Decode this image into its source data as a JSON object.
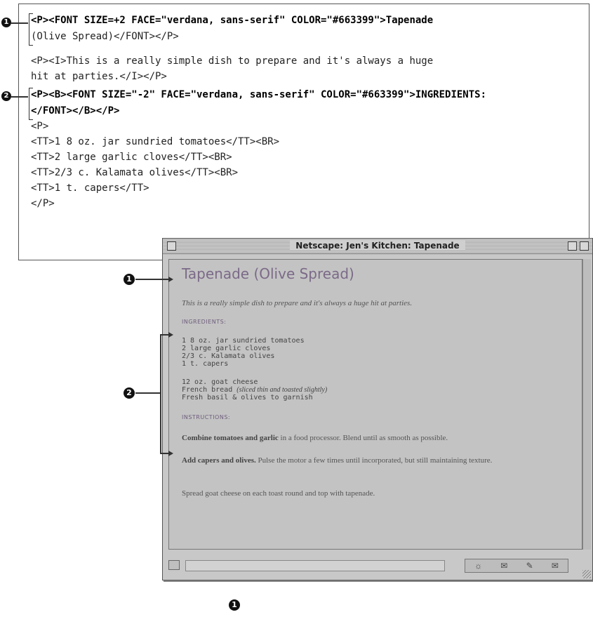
{
  "code_listing": {
    "lines": [
      "<P><FONT SIZE=+2 FACE=\"verdana, sans-serif\" COLOR=\"#663399\">Tapenade",
      "(Olive Spread)</FONT></P>",
      "<P><I>This is a really simple dish to prepare and it's always a huge",
      "hit at parties.</I></P>",
      "<P><B><FONT SIZE=\"-2\" FACE=\"verdana, sans-serif\" COLOR=\"#663399\">INGREDIENTS:",
      "</FONT></B></P>",
      "<P>",
      "<TT>1 8 oz. jar sundried tomatoes</TT><BR>",
      "<TT>2 large garlic cloves</TT><BR>",
      "<TT>2/3 c. Kalamata olives</TT><BR>",
      "<TT>1 t. capers</TT>",
      "</P>"
    ],
    "callout_1": "1",
    "callout_2": "2"
  },
  "browser_window": {
    "title": "Netscape: Jen's Kitchen: Tapenade",
    "page": {
      "heading": "Tapenade (Olive Spread)",
      "intro": "This is a really simple dish to prepare and it's always a huge hit at parties.",
      "ingredients_heading": "INGREDIENTS:",
      "ingredients": [
        "1 8 oz. jar sundried tomatoes",
        "2 large garlic cloves",
        "2/3 c. Kalamata olives",
        "1 t. capers"
      ],
      "extras": [
        "12 oz. goat cheese",
        "French bread",
        "(sliced thin and toasted slightly)",
        "Fresh basil & olives to garnish"
      ],
      "instructions_heading": "INSTRUCTIONS:",
      "step1_bold": "Combine tomatoes and garlic",
      "step1_rest": " in a food processor. Blend until as smooth as possible.",
      "step2_bold": "Add capers and olives.",
      "step2_rest": " Pulse the motor a few times until incorporated, but still maintaining texture.",
      "step3": "Spread goat cheese on each toast round and top with tapenade."
    },
    "status_text": ""
  },
  "figure_callouts": {
    "one": "1",
    "two": "2",
    "bottom_one": "1"
  }
}
